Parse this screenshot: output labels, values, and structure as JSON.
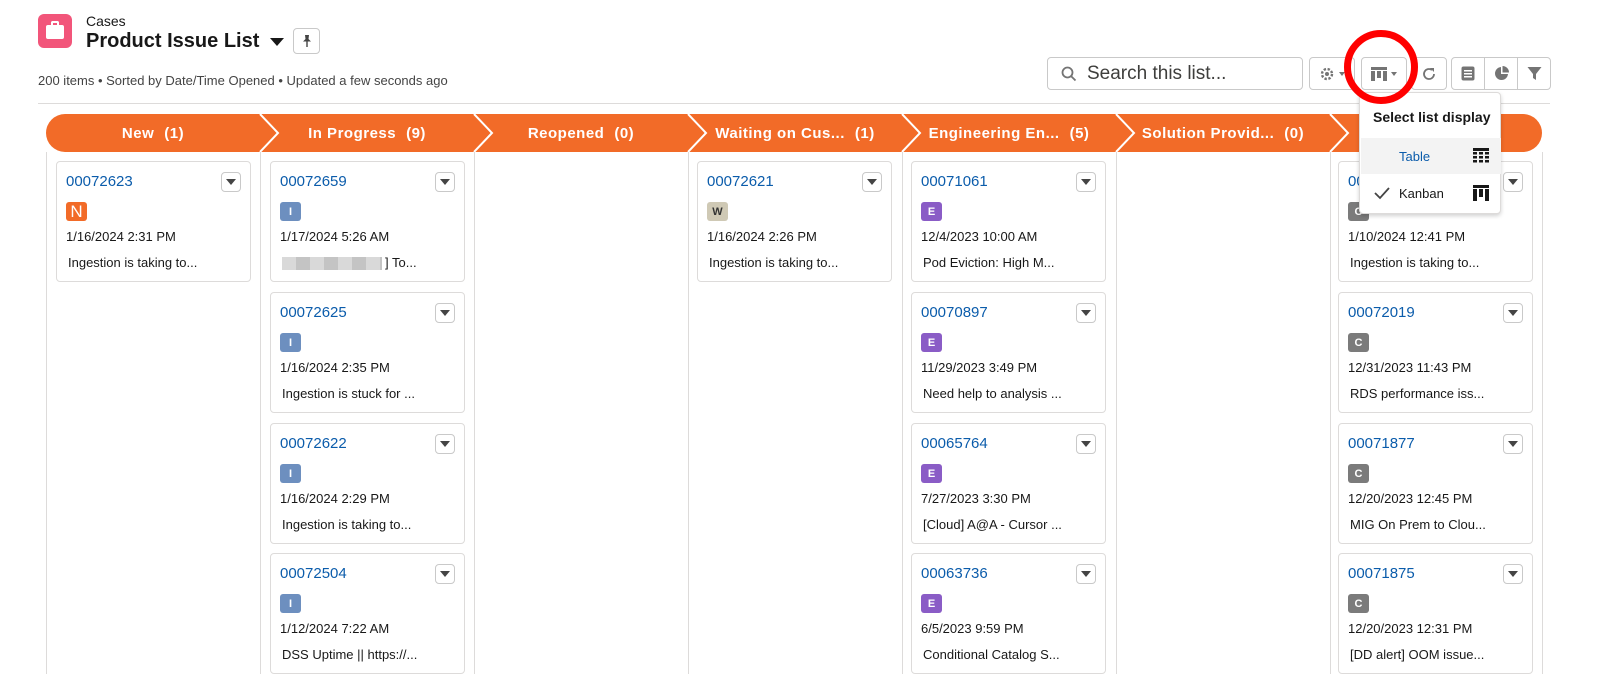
{
  "header": {
    "object_label": "Cases",
    "list_title": "Product Issue List",
    "meta": "200 items • Sorted by Date/Time Opened • Updated a few seconds ago"
  },
  "toolbar": {
    "search_placeholder": "Search this list..."
  },
  "display_menu": {
    "title": "Select list display",
    "options": [
      {
        "label": "Table",
        "selected": false
      },
      {
        "label": "Kanban",
        "selected": true
      }
    ]
  },
  "columns": [
    {
      "name": "New",
      "count": "(1)"
    },
    {
      "name": "In Progress",
      "count": "(9)"
    },
    {
      "name": "Reopened",
      "count": "(0)"
    },
    {
      "name": "Waiting on Cus...",
      "count": "(1)"
    },
    {
      "name": "Engineering En...",
      "count": "(5)"
    },
    {
      "name": "Solution Provid...",
      "count": "(0)"
    },
    {
      "name": "",
      "count": ""
    }
  ],
  "colors": {
    "stage": "#f26b28",
    "link": "#0b5cab",
    "badge_N": "#f26b28",
    "badge_I": "#6d8fbf",
    "badge_W": "#cfc9b5",
    "badge_E": "#8a5cc6",
    "badge_C": "#7b7b7b",
    "highlight": "#ff0000"
  },
  "cards": {
    "new": [
      {
        "number": "00072623",
        "badge": "N",
        "date": "1/16/2024 2:31 PM",
        "subject": "Ingestion is taking to..."
      }
    ],
    "in_progress": [
      {
        "number": "00072659",
        "badge": "I",
        "date": "1/17/2024 5:26 AM",
        "subject": "] To..."
      },
      {
        "number": "00072625",
        "badge": "I",
        "date": "1/16/2024 2:35 PM",
        "subject": "Ingestion is stuck for ..."
      },
      {
        "number": "00072622",
        "badge": "I",
        "date": "1/16/2024 2:29 PM",
        "subject": "Ingestion is taking to..."
      },
      {
        "number": "00072504",
        "badge": "I",
        "date": "1/12/2024 7:22 AM",
        "subject": "DSS Uptime || https://..."
      }
    ],
    "waiting": [
      {
        "number": "00072621",
        "badge": "W",
        "date": "1/16/2024 2:26 PM",
        "subject": "Ingestion is taking to..."
      }
    ],
    "engineering": [
      {
        "number": "00071061",
        "badge": "E",
        "date": "12/4/2023 10:00 AM",
        "subject": "Pod Eviction: High M..."
      },
      {
        "number": "00070897",
        "badge": "E",
        "date": "11/29/2023 3:49 PM",
        "subject": "Need help to analysis ..."
      },
      {
        "number": "00065764",
        "badge": "E",
        "date": "7/27/2023 3:30 PM",
        "subject": "[Cloud] A@A - Cursor ..."
      },
      {
        "number": "00063736",
        "badge": "E",
        "date": "6/5/2023 9:59 PM",
        "subject": "Conditional Catalog S..."
      }
    ],
    "last": [
      {
        "number": "00",
        "badge": "C",
        "date": "1/10/2024 12:41 PM",
        "subject": "Ingestion is taking to..."
      },
      {
        "number": "00072019",
        "badge": "C",
        "date": "12/31/2023 11:43 PM",
        "subject": "RDS performance iss..."
      },
      {
        "number": "00071877",
        "badge": "C",
        "date": "12/20/2023 12:45 PM",
        "subject": "MIG On Prem to Clou..."
      },
      {
        "number": "00071875",
        "badge": "C",
        "date": "12/20/2023 12:31 PM",
        "subject": "[DD alert] OOM issue..."
      }
    ]
  }
}
